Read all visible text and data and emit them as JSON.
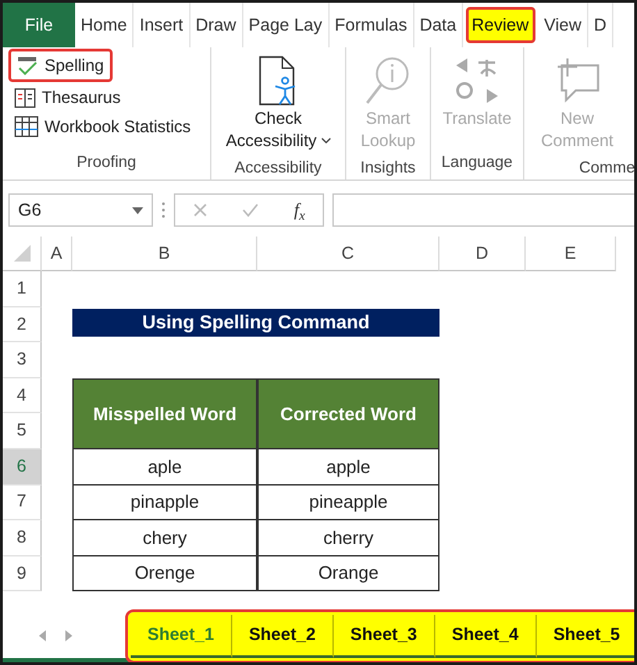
{
  "ribbon_tabs": [
    {
      "label": "File",
      "kind": "file",
      "selected": false,
      "highlighted": false
    },
    {
      "label": "Home",
      "kind": "tab",
      "selected": false,
      "highlighted": false
    },
    {
      "label": "Insert",
      "kind": "tab",
      "selected": false,
      "highlighted": false
    },
    {
      "label": "Draw",
      "kind": "tab",
      "selected": false,
      "highlighted": false
    },
    {
      "label": "Page Lay",
      "kind": "tab",
      "selected": false,
      "highlighted": false
    },
    {
      "label": "Formulas",
      "kind": "tab",
      "selected": false,
      "highlighted": false
    },
    {
      "label": "Data",
      "kind": "tab",
      "selected": false,
      "highlighted": false
    },
    {
      "label": "Review",
      "kind": "tab",
      "selected": true,
      "highlighted": true
    },
    {
      "label": "View",
      "kind": "tab",
      "selected": false,
      "highlighted": false
    },
    {
      "label": "D",
      "kind": "tab",
      "selected": false,
      "highlighted": false
    }
  ],
  "ribbon_groups": [
    {
      "label": "Proofing",
      "kind": "list",
      "commands": [
        {
          "label": "Spelling",
          "disabled": false,
          "highlighted": true
        },
        {
          "label": "Thesaurus",
          "disabled": false,
          "highlighted": false
        },
        {
          "label": "Workbook Statistics",
          "disabled": false,
          "highlighted": false
        }
      ]
    },
    {
      "label": "Accessibility",
      "kind": "large",
      "commands": [
        {
          "label": "Check",
          "label2": "Accessibility",
          "caret": true,
          "disabled": false,
          "highlighted": false
        }
      ]
    },
    {
      "label": "Insights",
      "kind": "large",
      "commands": [
        {
          "label": "Smart",
          "label2": "Lookup",
          "disabled": true,
          "highlighted": false
        }
      ]
    },
    {
      "label": "Language",
      "kind": "large",
      "commands": [
        {
          "label": "Translate",
          "disabled": true,
          "highlighted": false
        }
      ]
    },
    {
      "label": "Comme",
      "kind": "large",
      "commands": [
        {
          "label": "New",
          "label2": "Comment",
          "disabled": true,
          "highlighted": false
        }
      ]
    }
  ],
  "name_box": "G6",
  "fx_label": "f$_{x}$",
  "sheet": {
    "columns": [
      "A",
      "B",
      "C",
      "D",
      "E"
    ],
    "rows": [
      {
        "number": "1",
        "selected": false
      },
      {
        "number": "2",
        "selected": false
      },
      {
        "number": "3",
        "selected": false
      },
      {
        "number": "4",
        "selected": false
      },
      {
        "number": "5",
        "selected": false
      },
      {
        "number": "6",
        "selected": true
      },
      {
        "number": "7",
        "selected": false
      },
      {
        "number": "8",
        "selected": false
      },
      {
        "number": "9",
        "selected": false
      }
    ],
    "title": "Using Spelling Command",
    "table": {
      "columns": [
        "Misspelled Word",
        "Corrected Word"
      ],
      "rows": [
        [
          "aple",
          "apple"
        ],
        [
          "pinapple",
          "pineapple"
        ],
        [
          "chery",
          "cherry"
        ],
        [
          "Orenge",
          "Orange"
        ]
      ]
    }
  },
  "sheet_tabs": {
    "highlighted": true,
    "tabs": [
      {
        "label": "Sheet_1",
        "selected": true
      },
      {
        "label": "Sheet_2",
        "selected": false
      },
      {
        "label": "Sheet_3",
        "selected": false
      },
      {
        "label": "Sheet_4",
        "selected": false
      },
      {
        "label": "Sheet_5",
        "selected": false
      }
    ]
  }
}
